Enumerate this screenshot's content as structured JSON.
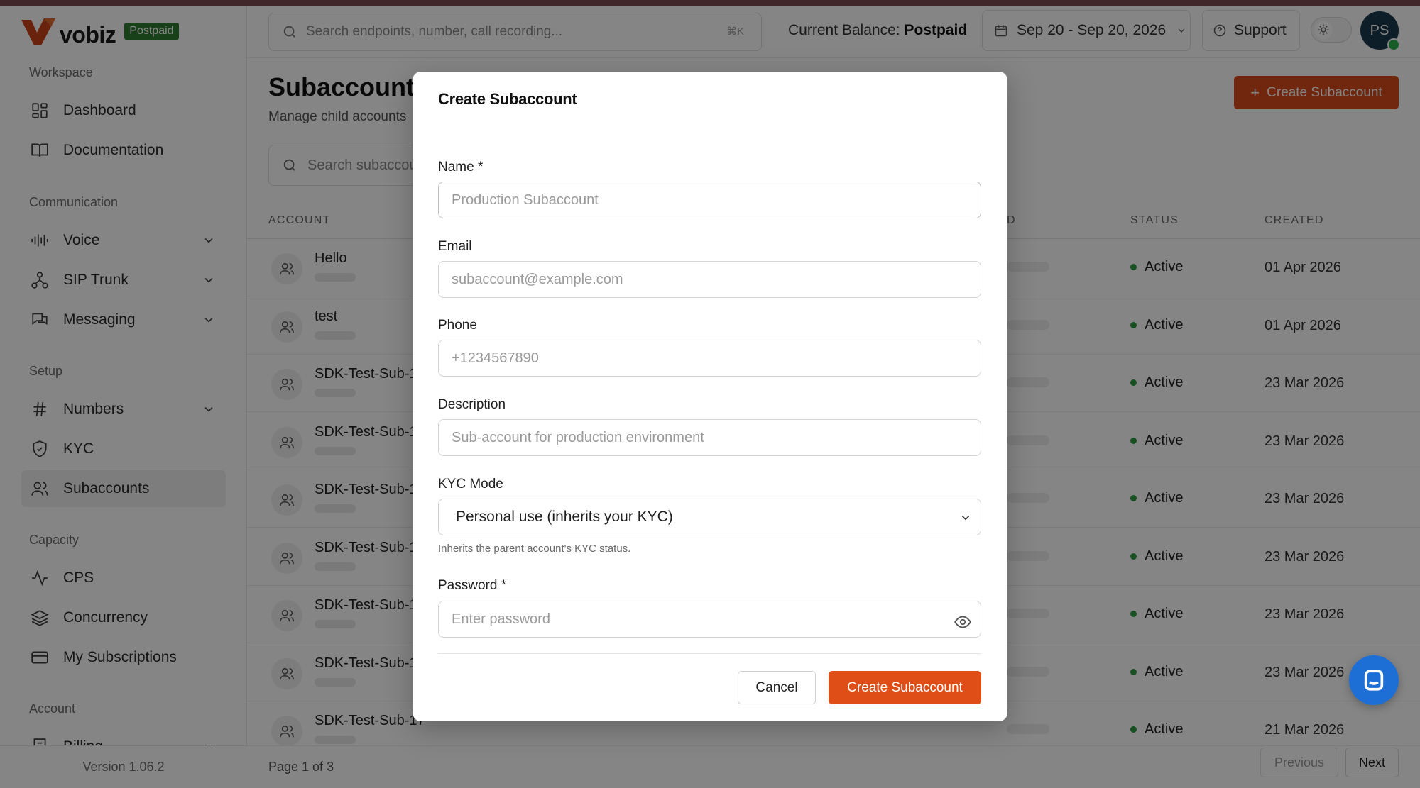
{
  "brand": {
    "name": "vobiz",
    "plan_badge": "Postpaid",
    "accent": "#d94a1c"
  },
  "topbar": {
    "search_placeholder": "Search endpoints, number, call recording...",
    "search_shortcut": "⌘K",
    "balance_label": "Current Balance:",
    "balance_value": "Postpaid",
    "date_range": "Sep 20 - Sep 20, 2026",
    "support_label": "Support",
    "avatar_initials": "PS"
  },
  "sidebar": {
    "sections": [
      {
        "title": "Workspace",
        "items": [
          {
            "label": "Dashboard",
            "icon": "dashboard-icon"
          },
          {
            "label": "Documentation",
            "icon": "book-icon"
          }
        ]
      },
      {
        "title": "Communication",
        "items": [
          {
            "label": "Voice",
            "icon": "waveform-icon",
            "expandable": true
          },
          {
            "label": "SIP Trunk",
            "icon": "network-icon",
            "expandable": true
          },
          {
            "label": "Messaging",
            "icon": "chat-icon",
            "expandable": true
          }
        ]
      },
      {
        "title": "Setup",
        "items": [
          {
            "label": "Numbers",
            "icon": "hash-icon",
            "expandable": true
          },
          {
            "label": "KYC",
            "icon": "shield-icon"
          },
          {
            "label": "Subaccounts",
            "icon": "users-icon",
            "active": true
          }
        ]
      },
      {
        "title": "Capacity",
        "items": [
          {
            "label": "CPS",
            "icon": "activity-icon"
          },
          {
            "label": "Concurrency",
            "icon": "layers-icon"
          },
          {
            "label": "My Subscriptions",
            "icon": "card-icon"
          }
        ]
      },
      {
        "title": "Account",
        "items": [
          {
            "label": "Billing",
            "icon": "receipt-icon",
            "expandable": true
          }
        ]
      }
    ],
    "version": "Version 1.06.2"
  },
  "page": {
    "title": "Subaccounts",
    "subtitle": "Manage child accounts",
    "create_button": "Create Subaccount",
    "search_placeholder": "Search subaccounts"
  },
  "table": {
    "headers": {
      "account": "ACCOUNT",
      "id": "D",
      "status": "STATUS",
      "created": "CREATED"
    },
    "rows": [
      {
        "name": "Hello",
        "status": "Active",
        "created": "01 Apr 2026"
      },
      {
        "name": "test",
        "status": "Active",
        "created": "01 Apr 2026"
      },
      {
        "name": "SDK-Test-Sub-1",
        "status": "Active",
        "created": "23 Mar 2026"
      },
      {
        "name": "SDK-Test-Sub-1",
        "status": "Active",
        "created": "23 Mar 2026"
      },
      {
        "name": "SDK-Test-Sub-1",
        "status": "Active",
        "created": "23 Mar 2026"
      },
      {
        "name": "SDK-Test-Sub-1",
        "status": "Active",
        "created": "23 Mar 2026"
      },
      {
        "name": "SDK-Test-Sub-1",
        "status": "Active",
        "created": "23 Mar 2026"
      },
      {
        "name": "SDK-Test-Sub-1",
        "status": "Active",
        "created": "23 Mar 2026"
      },
      {
        "name": "SDK-Test-Sub-17",
        "status": "Active",
        "created": "21 Mar 2026"
      }
    ]
  },
  "pagination": {
    "info": "Page 1 of 3",
    "previous": "Previous",
    "next": "Next"
  },
  "modal": {
    "title": "Create Subaccount",
    "name_label": "Name *",
    "name_placeholder": "Production Subaccount",
    "email_label": "Email",
    "email_placeholder": "subaccount@example.com",
    "phone_label": "Phone",
    "phone_placeholder": "+1234567890",
    "description_label": "Description",
    "description_placeholder": "Sub-account for production environment",
    "kyc_label": "KYC Mode",
    "kyc_value": "Personal use (inherits your KYC)",
    "kyc_help": "Inherits the parent account's KYC status.",
    "password_label": "Password *",
    "password_placeholder": "Enter password",
    "cancel": "Cancel",
    "submit": "Create Subaccount"
  }
}
